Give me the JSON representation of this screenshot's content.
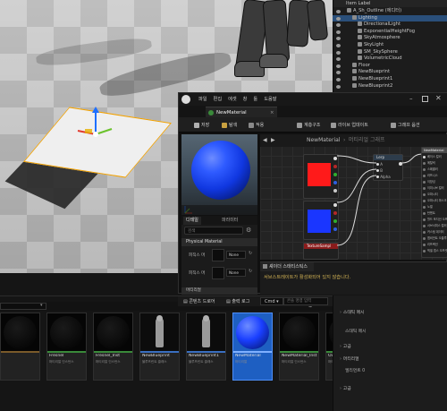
{
  "outliner": {
    "header": "Item Label",
    "items": [
      {
        "label": "A_Sh_Outline (에디터)",
        "indent": 0,
        "selected": false
      },
      {
        "label": "Lighting",
        "indent": 1,
        "selected": true
      },
      {
        "label": "DirectionalLight",
        "indent": 2,
        "selected": false
      },
      {
        "label": "ExponentialHeightFog",
        "indent": 2,
        "selected": false
      },
      {
        "label": "SkyAtmosphere",
        "indent": 2,
        "selected": false
      },
      {
        "label": "SkyLight",
        "indent": 2,
        "selected": false
      },
      {
        "label": "SM_SkySphere",
        "indent": 2,
        "selected": false
      },
      {
        "label": "VolumetricCloud",
        "indent": 2,
        "selected": false
      },
      {
        "label": "Floor",
        "indent": 1,
        "selected": false
      },
      {
        "label": "NewBlueprint",
        "indent": 1,
        "selected": false
      },
      {
        "label": "NewBlueprint1",
        "indent": 1,
        "selected": false
      },
      {
        "label": "NewBlueprint2",
        "indent": 1,
        "selected": false
      }
    ]
  },
  "material_editor": {
    "menu": [
      "파일",
      "편집",
      "에셋",
      "창",
      "툴",
      "도움말"
    ],
    "tab_title": "NewMaterial",
    "toolbar": {
      "save": "저장",
      "browse": "탐색",
      "apply": "적용",
      "hierarchy": "계층구조",
      "live_update": "라이브 업데이트",
      "graph_options": "그래프 옵션"
    },
    "graph": {
      "breadcrumb_asset": "NewMaterial",
      "breadcrumb_graph": "머티리얼 그래프",
      "multiply_node": "Lerp",
      "lerp_pins": [
        "A",
        "B",
        "Alpha"
      ],
      "texture_node": "TextureSampl",
      "material_node_title": "NewMaterial",
      "material_pins": [
        "베이스 컬러",
        "메탈릭",
        "스페큘러",
        "러프니스",
        "이방성",
        "이미시브 컬러",
        "오파시티",
        "오파시티 마스크",
        "노멀",
        "탄젠트",
        "월드 포지션 오프셋",
        "서브서피스 컬러",
        "커스텀 데이터",
        "앰비언트 오클루전",
        "리프랙션",
        "픽셀 뎁스 오프셋"
      ]
    },
    "colors": {
      "red": "#ff1a1a",
      "blue": "#1a36ff"
    },
    "details": {
      "tabs": [
        "디테일",
        "파라미터"
      ],
      "search_placeholder": "검색",
      "section": "Physical Material",
      "rows": [
        {
          "label": "피직스 머",
          "value": "None"
        },
        {
          "label": "피직스 머",
          "value": "None"
        }
      ],
      "section2": "머티리얼"
    },
    "stats": {
      "tab": "셰이더 스태티스틱스",
      "message": "서브스트레이트가 활성화되어 있지 않습니다."
    }
  },
  "content_browser": {
    "tabs": [
      "콘텐츠 드로어",
      "출력 로그",
      "Cmd"
    ],
    "cmd_placeholder": "콘솔 명령 입력",
    "assets": [
      {
        "name": "",
        "type": "",
        "thumb": "dark",
        "bar": "#7a5a2a",
        "selected": false
      },
      {
        "name": "Fresnel",
        "type": "머티리얼 인스턴스",
        "thumb": "dark",
        "bar": "#3a8a3a",
        "selected": false
      },
      {
        "name": "Fresnel_Inst",
        "type": "머티리얼 인스턴스",
        "thumb": "dark",
        "bar": "#3a8a3a",
        "selected": false
      },
      {
        "name": "NewBlueprint",
        "type": "블루프린트 클래스",
        "thumb": "figure",
        "bar": "#3a6fc0",
        "selected": false
      },
      {
        "name": "NewBlueprint1",
        "type": "블루프린트 클래스",
        "thumb": "figure",
        "bar": "#3a6fc0",
        "selected": false
      },
      {
        "name": "NewMaterial",
        "type": "머티리얼",
        "thumb": "sphere",
        "bar": "#7fb0ff",
        "selected": true
      },
      {
        "name": "NewMaterial_Inst",
        "type": "머티리얼 인스턴스",
        "thumb": "dark",
        "bar": "#3a8a3a",
        "selected": false
      },
      {
        "name": "Outline",
        "type": "머티리얼 인스턴스",
        "thumb": "dark",
        "bar": "#3a8a3a",
        "selected": false
      }
    ]
  },
  "details_side": {
    "rows": [
      {
        "label": "스태틱 메시",
        "kind": "section"
      },
      {
        "label": "스태틱 메시",
        "kind": "row"
      },
      {
        "label": "고급",
        "kind": "section"
      },
      {
        "label": "머티리얼",
        "kind": "section"
      },
      {
        "label": "엘리먼트 0",
        "kind": "row"
      },
      {
        "label": "고급",
        "kind": "section"
      }
    ]
  }
}
